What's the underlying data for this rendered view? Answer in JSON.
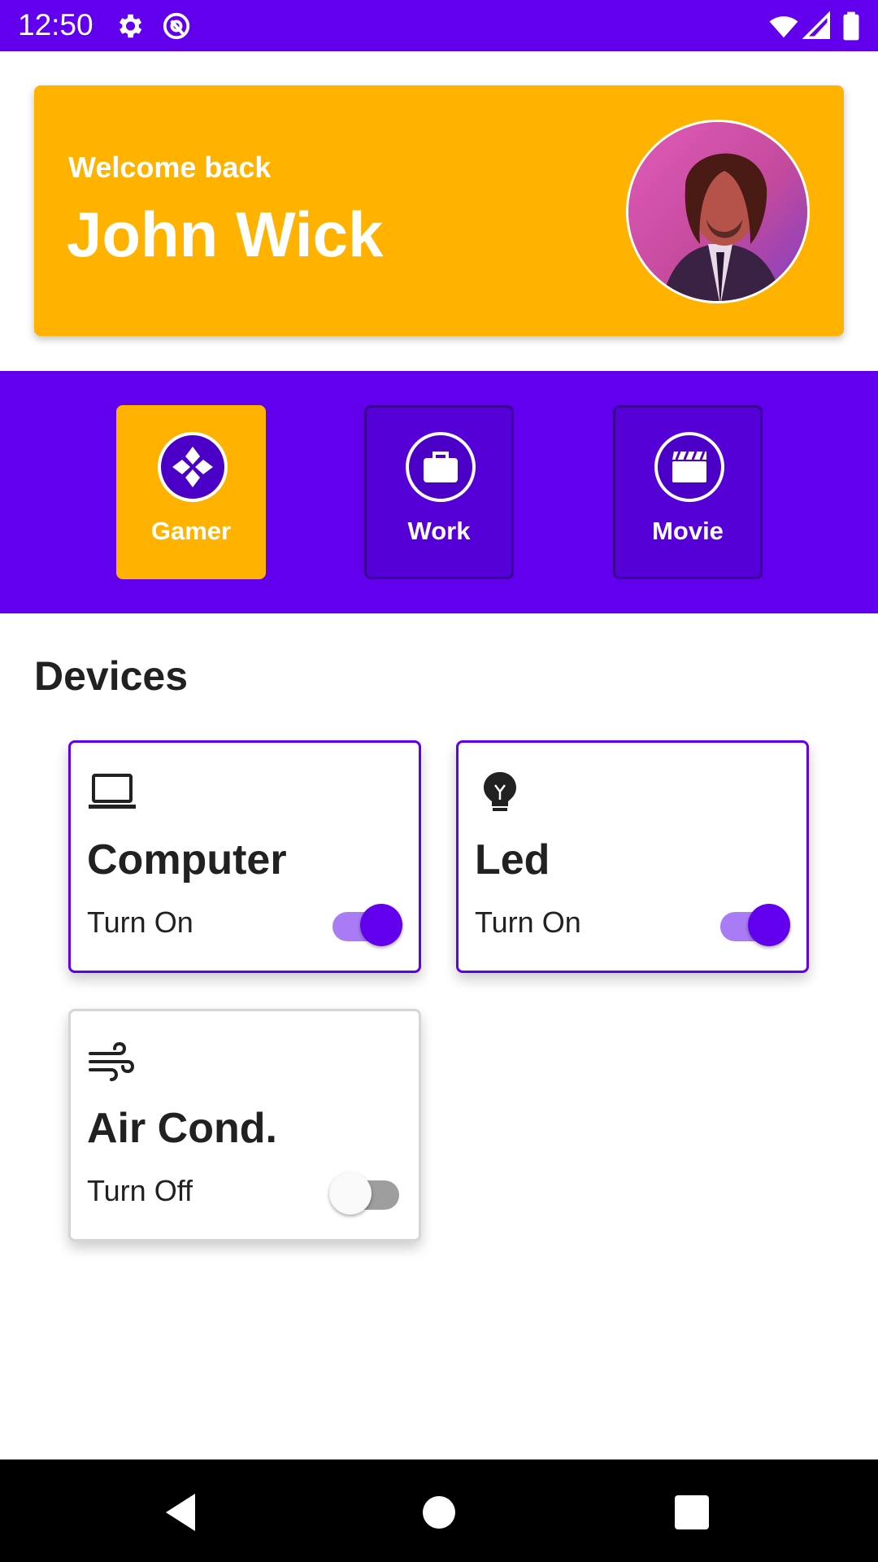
{
  "status_bar": {
    "time": "12:50",
    "icons": [
      "settings-icon",
      "at-sign-icon",
      "wifi-icon",
      "signal-icon",
      "battery-icon"
    ],
    "color": "#6200ee"
  },
  "welcome": {
    "greeting": "Welcome back",
    "name": "John Wick",
    "avatar_icon": "avatar-photo",
    "color": "#ffb300"
  },
  "modes": [
    {
      "label": "Gamer",
      "icon": "gamepad-icon",
      "active": true
    },
    {
      "label": "Work",
      "icon": "briefcase-icon",
      "active": false
    },
    {
      "label": "Movie",
      "icon": "clapperboard-icon",
      "active": false
    }
  ],
  "devices_section": {
    "title": "Devices"
  },
  "devices": [
    {
      "name": "Computer",
      "status": "Turn On",
      "icon": "laptop-icon",
      "on": true
    },
    {
      "name": "Led",
      "status": "Turn On",
      "icon": "lightbulb-icon",
      "on": true
    },
    {
      "name": "Air Cond.",
      "status": "Turn Off",
      "icon": "wind-icon",
      "on": false
    }
  ],
  "nav_bar": {
    "buttons": [
      "back-icon",
      "home-icon",
      "recents-icon"
    ]
  },
  "colors": {
    "primary": "#6200ee",
    "accent": "#ffb300",
    "switch_track_on": "#a97cf5"
  }
}
